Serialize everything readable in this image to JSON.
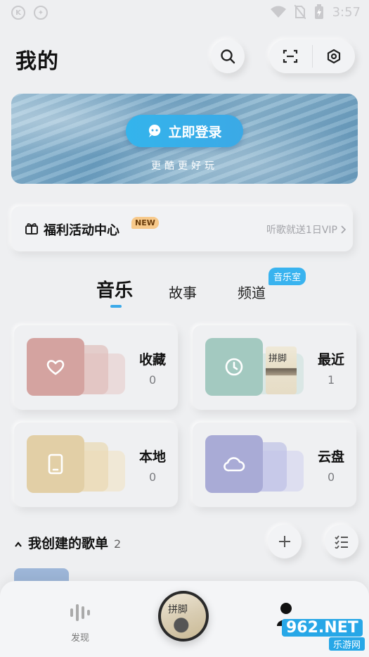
{
  "status_bar": {
    "time": "3:57"
  },
  "header": {
    "title": "我的"
  },
  "banner": {
    "login_label": "立即登录",
    "subtitle": "更酷更好玩"
  },
  "welfare": {
    "title": "福利活动中心",
    "badge": "NEW",
    "right_text": "听歌就送1日VIP"
  },
  "tabs": [
    {
      "label": "音乐",
      "active": true
    },
    {
      "label": "故事",
      "active": false
    },
    {
      "label": "频道",
      "active": false,
      "badge": "音乐室"
    }
  ],
  "library": [
    {
      "title": "收藏",
      "count": "0",
      "icon": "heart-icon",
      "color": "#d4a3a0"
    },
    {
      "title": "最近",
      "count": "1",
      "icon": "clock-icon",
      "color": "#a3c9c0",
      "cover_text": "拼脚"
    },
    {
      "title": "本地",
      "count": "0",
      "icon": "phone-icon",
      "color": "#e2cfa6"
    },
    {
      "title": "云盘",
      "count": "0",
      "icon": "cloud-icon",
      "color": "#a9abd6"
    }
  ],
  "playlists": {
    "title": "我创建的歌单",
    "count": "2"
  },
  "bottom_nav": {
    "discover_label": "发现",
    "disc_text": "拼脚",
    "accent": "#3aa9e9"
  },
  "watermark": {
    "number": "962.NET",
    "text": "乐游网"
  }
}
